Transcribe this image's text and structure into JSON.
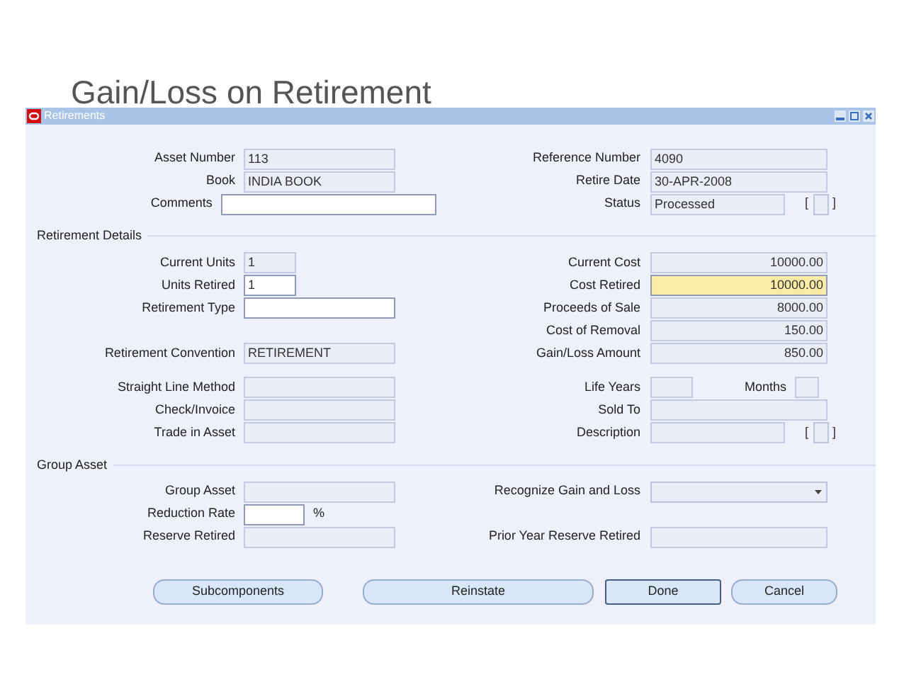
{
  "slide_title": "Gain/Loss on Retirement",
  "window": {
    "title": "Retirements"
  },
  "sections": [
    {
      "rows": [
        {
          "left": {
            "label": "Asset Number",
            "value": "113",
            "kind": "text",
            "editable": false
          },
          "right": {
            "label": "Reference Number",
            "value": "4090",
            "kind": "text",
            "editable": false
          }
        },
        {
          "left": {
            "label": "Book",
            "value": "INDIA BOOK",
            "kind": "text",
            "editable": false
          },
          "right": {
            "label": "Retire Date",
            "value": "30-APR-2008",
            "kind": "text",
            "editable": false
          }
        },
        {
          "left": {
            "label": "Comments",
            "kind": "wide",
            "editable": true
          },
          "right": {
            "label": "Status",
            "value": "Processed",
            "kind": "status",
            "editable": false,
            "flex_open": "[",
            "flex_close": "]"
          }
        }
      ]
    },
    {
      "title": "Retirement Details",
      "groups": [
        {
          "rows": [
            {
              "left": {
                "label": "Current Units",
                "value": "1",
                "kind": "short",
                "editable": false
              },
              "right": {
                "label": "Current Cost",
                "value": "10000.00",
                "kind": "text",
                "editable": false,
                "numeric": true
              }
            },
            {
              "left": {
                "label": "Units Retired",
                "value": "1",
                "kind": "short",
                "editable": true
              },
              "right": {
                "label": "Cost Retired",
                "value": "10000.00",
                "kind": "text",
                "editable": true,
                "highlighted": true,
                "numeric": true
              }
            },
            {
              "left": {
                "label": "Retirement Type",
                "kind": "text",
                "editable": true
              },
              "right": {
                "label": "Proceeds of Sale",
                "value": "8000.00",
                "kind": "text",
                "editable": false,
                "numeric": true
              }
            },
            {
              "right": {
                "label": "Cost of Removal",
                "value": "150.00",
                "kind": "text",
                "editable": false,
                "numeric": true
              }
            },
            {
              "left": {
                "label": "Retirement Convention",
                "value": "RETIREMENT",
                "kind": "text",
                "editable": false
              },
              "right": {
                "label": "Gain/Loss Amount",
                "value": "850.00",
                "kind": "text",
                "editable": false,
                "numeric": true
              }
            }
          ]
        },
        {
          "rows": [
            {
              "left": {
                "label": "Straight Line Method",
                "kind": "text",
                "editable": false
              },
              "right": {
                "label": "Life Years",
                "kind": "life",
                "editable": false,
                "months_label": "Months"
              }
            },
            {
              "left": {
                "label": "Check/Invoice",
                "kind": "text",
                "editable": false
              },
              "right": {
                "label": "Sold To",
                "kind": "text",
                "editable": false
              }
            },
            {
              "left": {
                "label": "Trade in Asset",
                "kind": "text",
                "editable": false
              },
              "right": {
                "label": "Description",
                "kind": "status",
                "editable": false,
                "flex_open": "[",
                "flex_close": "]"
              }
            }
          ]
        }
      ]
    },
    {
      "title": "Group Asset",
      "rows": [
        {
          "left": {
            "label": "Group Asset",
            "kind": "text",
            "editable": false
          },
          "right": {
            "label": "Recognize Gain and Loss",
            "kind": "dropdown",
            "editable": true
          }
        },
        {
          "left": {
            "label": "Reduction Rate",
            "kind": "percent",
            "editable": true,
            "suffix": "%"
          }
        },
        {
          "left": {
            "label": "Reserve Retired",
            "kind": "text",
            "editable": false
          },
          "right": {
            "label": "Prior Year Reserve Retired",
            "kind": "text",
            "editable": false
          }
        }
      ]
    }
  ],
  "buttons": [
    {
      "label": "Subcomponents",
      "default": false
    },
    {
      "label": "Reinstate",
      "default": false
    },
    {
      "label": "Done",
      "default": true
    },
    {
      "label": "Cancel",
      "default": false
    }
  ]
}
